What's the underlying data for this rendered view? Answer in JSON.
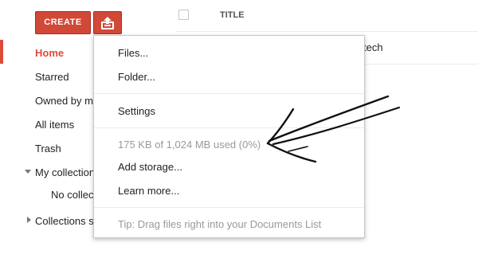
{
  "toolbar": {
    "create_label": "CREATE",
    "upload_icon": "upload-icon"
  },
  "list": {
    "column_title": "TITLE",
    "row_partial_text": "tech"
  },
  "sidebar": {
    "items": [
      {
        "label": "Home",
        "active": true
      },
      {
        "label": "Starred"
      },
      {
        "label": "Owned by me"
      },
      {
        "label": "All items"
      },
      {
        "label": "Trash"
      },
      {
        "label": "My collections"
      },
      {
        "label": "No collections"
      },
      {
        "label": "Collections shared with me"
      }
    ]
  },
  "menu": {
    "files": "Files...",
    "folder": "Folder...",
    "settings": "Settings",
    "storage_used": "175 KB of 1,024 MB used (0%)",
    "add_storage": "Add storage...",
    "learn_more": "Learn more...",
    "tip": "Tip: Drag files right into your Documents List"
  },
  "colors": {
    "accent_red": "#d14836",
    "active_nav": "#dd4b39",
    "muted_text": "#999999"
  }
}
